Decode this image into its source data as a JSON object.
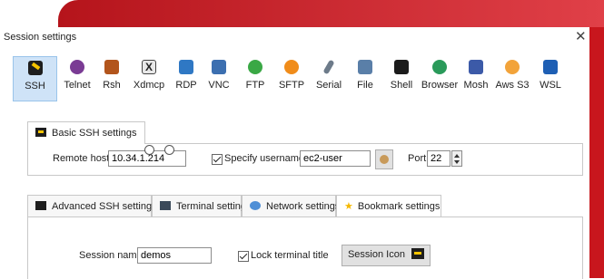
{
  "window": {
    "title": "Session settings",
    "close_glyph": "✕"
  },
  "session_types": [
    {
      "label": "SSH",
      "icon": "ssh-icon",
      "color": "#222222",
      "selected": true
    },
    {
      "label": "Telnet",
      "icon": "telnet-icon",
      "color": "#7a3b94"
    },
    {
      "label": "Rsh",
      "icon": "rsh-icon",
      "color": "#b2551c"
    },
    {
      "label": "Xdmcp",
      "icon": "xdmcp-icon",
      "color": "#4a4a4a"
    },
    {
      "label": "RDP",
      "icon": "rdp-icon",
      "color": "#2f78c4"
    },
    {
      "label": "VNC",
      "icon": "vnc-icon",
      "color": "#3c6fb0"
    },
    {
      "label": "FTP",
      "icon": "ftp-icon",
      "color": "#3aa845"
    },
    {
      "label": "SFTP",
      "icon": "sftp-icon",
      "color": "#f08c1a"
    },
    {
      "label": "Serial",
      "icon": "serial-icon",
      "color": "#6d7b8a"
    },
    {
      "label": "File",
      "icon": "file-icon",
      "color": "#5a7fa8"
    },
    {
      "label": "Shell",
      "icon": "shell-icon",
      "color": "#1b1b1b"
    },
    {
      "label": "Browser",
      "icon": "browser-icon",
      "color": "#2a9a5a"
    },
    {
      "label": "Mosh",
      "icon": "mosh-icon",
      "color": "#3c5aa8"
    },
    {
      "label": "Aws S3",
      "icon": "aws-s3-icon",
      "color": "#f2a33a"
    },
    {
      "label": "WSL",
      "icon": "wsl-icon",
      "color": "#1e5fb4"
    }
  ],
  "basic": {
    "tab_label": "Basic SSH settings",
    "remote_host_label": "Remote host *",
    "remote_host_value": "10.34.1.214",
    "specify_username_label": "Specify username",
    "username_value": "ec2-user",
    "port_label": "Port",
    "port_value": "22"
  },
  "bottom_tabs": [
    {
      "label": "Advanced SSH settings",
      "icon": "terminal-icon"
    },
    {
      "label": "Terminal settings",
      "icon": "monitor-icon"
    },
    {
      "label": "Network settings",
      "icon": "network-icon"
    },
    {
      "label": "Bookmark settings",
      "icon": "star-icon",
      "active": true
    }
  ],
  "bookmark": {
    "session_name_label": "Session name:",
    "session_name_value": "demos",
    "lock_terminal_label": "Lock terminal title",
    "session_icon_button": "Session Icon"
  },
  "colors": {
    "accent_red": "#c8161d",
    "selection_blue": "#cfe3f7",
    "star": "#f5b800"
  }
}
